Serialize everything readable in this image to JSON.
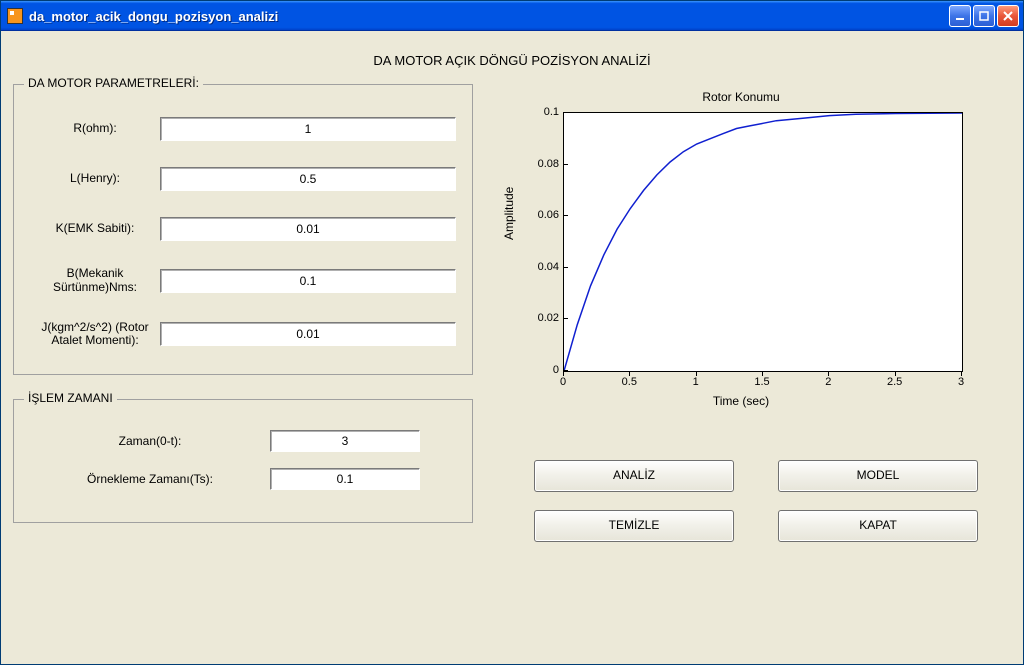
{
  "window": {
    "title": "da_motor_acik_dongu_pozisyon_analizi"
  },
  "main_title": "DA MOTOR AÇIK DÖNGÜ POZİSYON ANALİZİ",
  "params_box": {
    "legend": "DA MOTOR PARAMETRELERİ:",
    "rows": [
      {
        "label": "R(ohm):",
        "value": "1"
      },
      {
        "label": "L(Henry):",
        "value": "0.5"
      },
      {
        "label": "K(EMK Sabiti):",
        "value": "0.01"
      },
      {
        "label": "B(Mekanik Sürtünme)Nms:",
        "value": "0.1"
      },
      {
        "label": "J(kgm^2/s^2) (Rotor Atalet Momenti):",
        "value": "0.01"
      }
    ]
  },
  "time_box": {
    "legend": "İŞLEM ZAMANI",
    "rows": [
      {
        "label": "Zaman(0-t):",
        "value": "3"
      },
      {
        "label": "Örnekleme Zamanı(Ts):",
        "value": "0.1"
      }
    ]
  },
  "buttons": {
    "analyze": "ANALİZ",
    "model": "MODEL",
    "clear": "TEMİZLE",
    "close": "KAPAT"
  },
  "chart_data": {
    "type": "line",
    "title": "Rotor Konumu",
    "xlabel": "Time (sec)",
    "ylabel": "Amplitude",
    "xlim": [
      0,
      3
    ],
    "ylim": [
      0,
      0.1
    ],
    "xticks": [
      0,
      0.5,
      1,
      1.5,
      2,
      2.5,
      3
    ],
    "yticks": [
      0,
      0.02,
      0.04,
      0.06,
      0.08,
      0.1
    ],
    "series": [
      {
        "name": "Rotor Konumu",
        "color": "#1020d0",
        "x": [
          0,
          0.1,
          0.2,
          0.3,
          0.4,
          0.5,
          0.6,
          0.7,
          0.8,
          0.9,
          1.0,
          1.1,
          1.2,
          1.3,
          1.4,
          1.5,
          1.6,
          1.8,
          2.0,
          2.2,
          2.5,
          3.0
        ],
        "y": [
          0,
          0.018,
          0.033,
          0.045,
          0.055,
          0.063,
          0.07,
          0.076,
          0.081,
          0.085,
          0.088,
          0.09,
          0.092,
          0.094,
          0.095,
          0.096,
          0.097,
          0.098,
          0.099,
          0.0995,
          0.0998,
          0.1
        ]
      }
    ]
  }
}
